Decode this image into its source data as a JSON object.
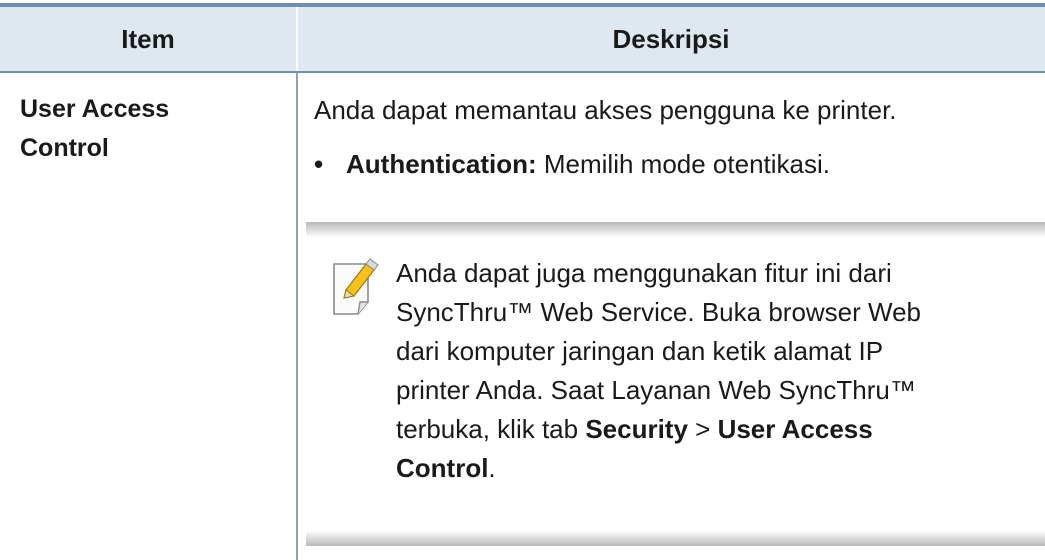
{
  "table": {
    "header": {
      "item": "Item",
      "description": "Deskripsi"
    },
    "row": {
      "item_line1": "User Access",
      "item_line2": "Control",
      "description": "Anda dapat memantau akses pengguna ke printer.",
      "bullet": {
        "symbol": "•",
        "term": "Authentication:",
        "text": " Memilih mode otentikasi."
      },
      "note": {
        "icon": "note-pencil-icon",
        "line1": "Anda dapat juga menggunakan fitur ini dari",
        "line2": "SyncThru™ Web Service. Buka browser Web",
        "line3": "dari komputer jaringan dan ketik alamat IP",
        "line4": "printer Anda. Saat Layanan Web SyncThru™",
        "line5_prefix": "terbuka, klik tab ",
        "security": "Security",
        "sep": " > ",
        "uac_part1": "User Access",
        "uac_part2": "Control",
        "period": "."
      }
    }
  },
  "colors": {
    "rule": "#6f8fae",
    "header_bg": "#dfe8f0",
    "icon_yellow": "#f4c21b"
  }
}
